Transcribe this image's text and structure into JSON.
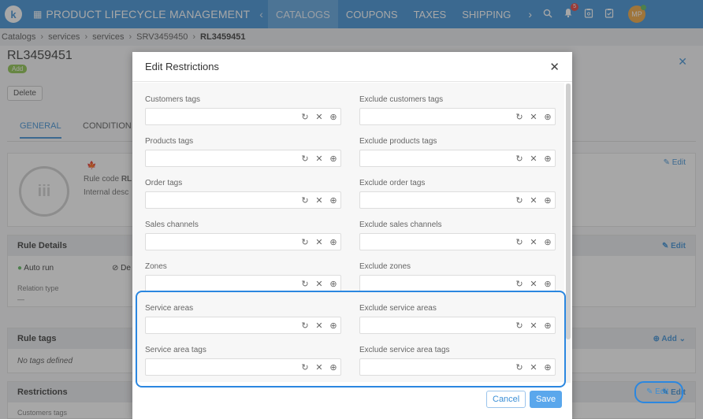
{
  "topbar": {
    "logo": "k",
    "app_title": "PRODUCT LIFECYCLE MANAGEMENT",
    "nav_items": [
      "CATALOGS",
      "COUPONS",
      "TAXES",
      "SHIPPING"
    ],
    "notification_count": "5",
    "avatar_initials": "MP",
    "accent_color": "#3b8fd6"
  },
  "breadcrumb": [
    "Catalogs",
    "services",
    "services",
    "SRV3459450",
    "RL3459451"
  ],
  "page": {
    "title": "RL3459451",
    "status_badge": "Add",
    "delete_label": "Delete",
    "tabs": [
      "GENERAL",
      "CONDITION"
    ],
    "rule_code_label": "Rule code",
    "rule_code_value": "RL",
    "internal_desc_label": "Internal desc",
    "edit_label": "Edit",
    "rule_details": {
      "title": "Rule Details",
      "auto_run": "Auto run",
      "second_option": "De",
      "relation_type_label": "Relation type",
      "relation_type_value": "—"
    },
    "rule_tags": {
      "title": "Rule tags",
      "add_label": "Add",
      "empty_text": "No tags defined"
    },
    "restrictions": {
      "title": "Restrictions",
      "first_row_label": "Customers tags"
    }
  },
  "modal": {
    "title": "Edit Restrictions",
    "fields": [
      {
        "label": "Customers tags",
        "value": ""
      },
      {
        "label": "Exclude customers tags",
        "value": ""
      },
      {
        "label": "Products tags",
        "value": ""
      },
      {
        "label": "Exclude products tags",
        "value": ""
      },
      {
        "label": "Order tags",
        "value": ""
      },
      {
        "label": "Exclude order tags",
        "value": ""
      },
      {
        "label": "Sales channels",
        "value": ""
      },
      {
        "label": "Exclude sales channels",
        "value": ""
      },
      {
        "label": "Zones",
        "value": ""
      },
      {
        "label": "Exclude zones",
        "value": ""
      },
      {
        "label": "Service areas",
        "value": ""
      },
      {
        "label": "Exclude service areas",
        "value": ""
      },
      {
        "label": "Service area tags",
        "value": ""
      },
      {
        "label": "Exclude service area tags",
        "value": ""
      }
    ],
    "cancel_label": "Cancel",
    "save_label": "Save"
  },
  "icons": {
    "refresh": "refresh-icon",
    "clear": "clear-icon",
    "add": "add-circle-icon"
  }
}
